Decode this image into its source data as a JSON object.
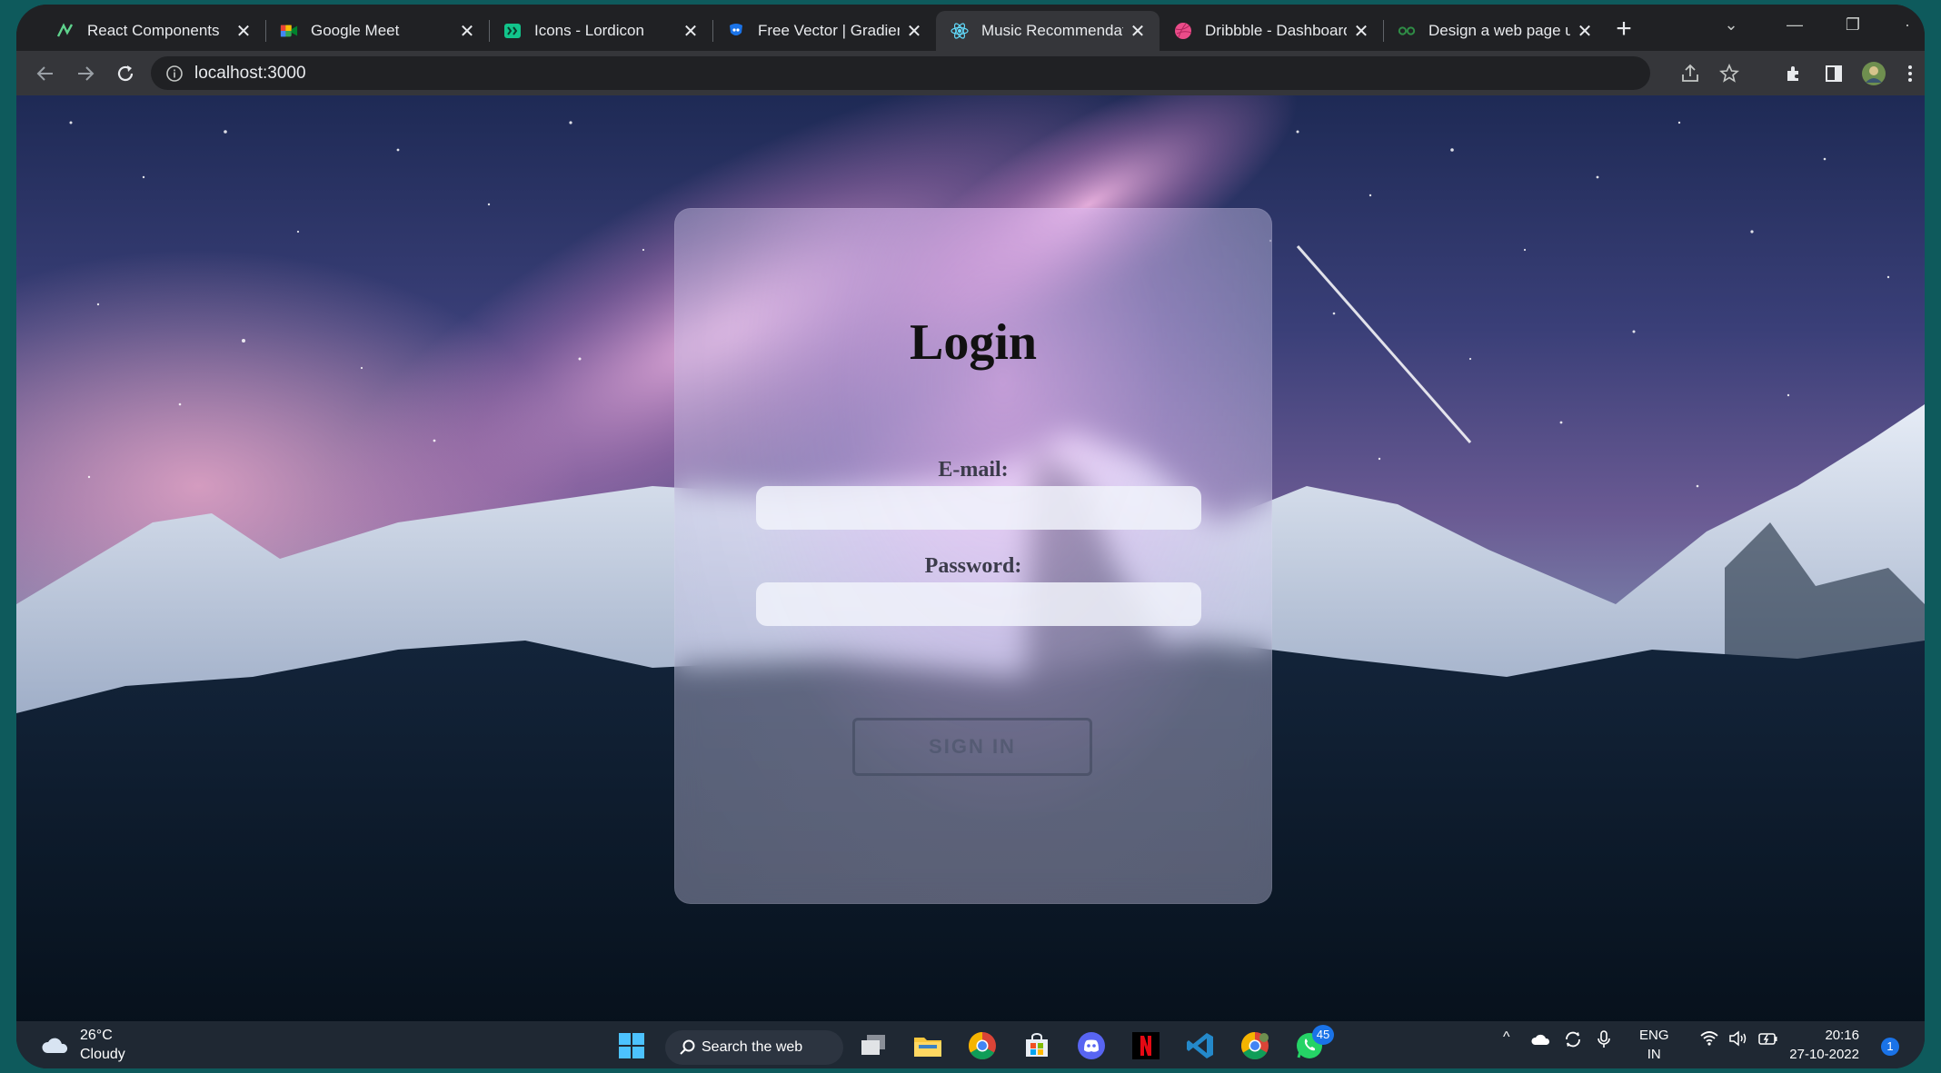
{
  "browser": {
    "tabs": [
      {
        "title": "React Components",
        "icon": "react-icon",
        "active": false
      },
      {
        "title": "Google Meet",
        "icon": "google-meet-icon",
        "active": false
      },
      {
        "title": "Icons - Lordicon",
        "icon": "lordicon-icon",
        "active": false
      },
      {
        "title": "Free Vector | Gradient",
        "icon": "freepik-icon",
        "active": false
      },
      {
        "title": "Music Recommendati",
        "icon": "react-atom-icon",
        "active": true
      },
      {
        "title": "Dribbble - Dashboard",
        "icon": "dribbble-icon",
        "active": false
      },
      {
        "title": "Design a web page u",
        "icon": "geeks-icon",
        "active": false
      }
    ],
    "url": "localhost:3000"
  },
  "login": {
    "title": "Login",
    "email_label": "E-mail:",
    "email_value": "",
    "password_label": "Password:",
    "password_value": "",
    "signin_label": "SIGN IN"
  },
  "taskbar": {
    "weather_temp": "26°C",
    "weather_status": "Cloudy",
    "search_label": "Search the web",
    "whatsapp_badge": "45",
    "lang_top": "ENG",
    "lang_bottom": "IN",
    "time": "20:16",
    "date": "27-10-2022",
    "notification_count": "1"
  },
  "colors": {
    "page_bg": "#0e5a5c",
    "tabstrip_bg": "#202124",
    "toolbar_bg": "#35363a",
    "taskbar_bg": "#1f2833"
  }
}
